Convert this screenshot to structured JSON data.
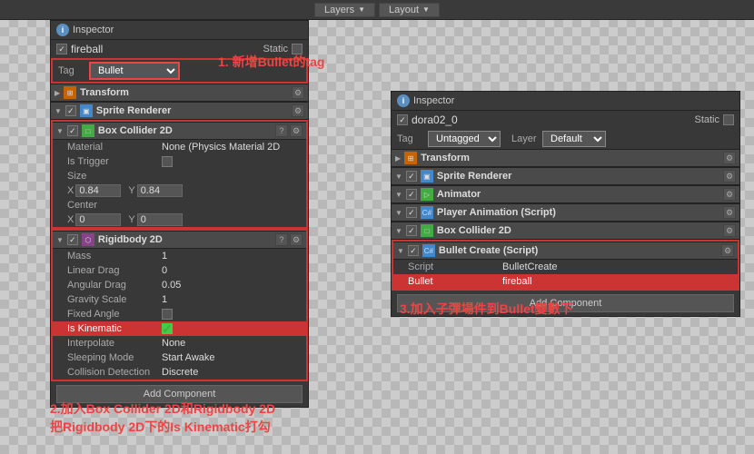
{
  "topbar": {
    "layers_label": "Layers",
    "layout_label": "Layout"
  },
  "left_inspector": {
    "title": "Inspector",
    "object_name": "fireball",
    "static_label": "Static",
    "tag_label": "Tag",
    "tag_value": "Bullet",
    "sections": {
      "transform": "Transform",
      "sprite_renderer": "Sprite Renderer",
      "box_collider": "Box Collider 2D",
      "rigidbody": "Rigidbody 2D"
    },
    "box_collider": {
      "material_label": "Material",
      "material_value": "None (Physics Material 2D",
      "is_trigger_label": "Is Trigger",
      "size_label": "Size",
      "size_x": "0.84",
      "size_y": "0.84",
      "center_label": "Center",
      "center_x": "0",
      "center_y": "0"
    },
    "rigidbody": {
      "mass_label": "Mass",
      "mass_value": "1",
      "linear_drag_label": "Linear Drag",
      "linear_drag_value": "0",
      "angular_drag_label": "Angular Drag",
      "angular_drag_value": "0.05",
      "gravity_scale_label": "Gravity Scale",
      "gravity_scale_value": "1",
      "fixed_angle_label": "Fixed Angle",
      "is_kinematic_label": "Is Kinematic",
      "interpolate_label": "Interpolate",
      "sleeping_mode_label": "Sleeping Mode",
      "sleeping_mode_value": "Start Awake",
      "collision_detection_label": "Collision Detection",
      "collision_detection_value": "Discrete"
    },
    "add_component": "Add Component"
  },
  "right_inspector": {
    "title": "Inspector",
    "object_name": "dora02_0",
    "static_label": "Static",
    "tag_label": "Tag",
    "tag_value": "Untagged",
    "layer_label": "Layer",
    "layer_value": "Default",
    "sections": {
      "transform": "Transform",
      "sprite_renderer": "Sprite Renderer",
      "animator": "Animator",
      "player_animation": "Player Animation (Script)",
      "box_collider": "Box Collider 2D",
      "bullet_create": "Bullet Create (Script)"
    },
    "bullet_create": {
      "script_label": "Script",
      "script_value": "BulletCreate",
      "bullet_label": "Bullet",
      "bullet_value": "fireball"
    },
    "add_component": "Add Component"
  },
  "annotations": {
    "text1": "1. 新增Bullet的tag",
    "text2_line1": "2.加入Box Collider 2D和Rigidbody 2D",
    "text2_line2": "把Rigidbody 2D下的Is Kinematic打勾",
    "text3": "3.加入子彈場件到Bullet變數下"
  }
}
